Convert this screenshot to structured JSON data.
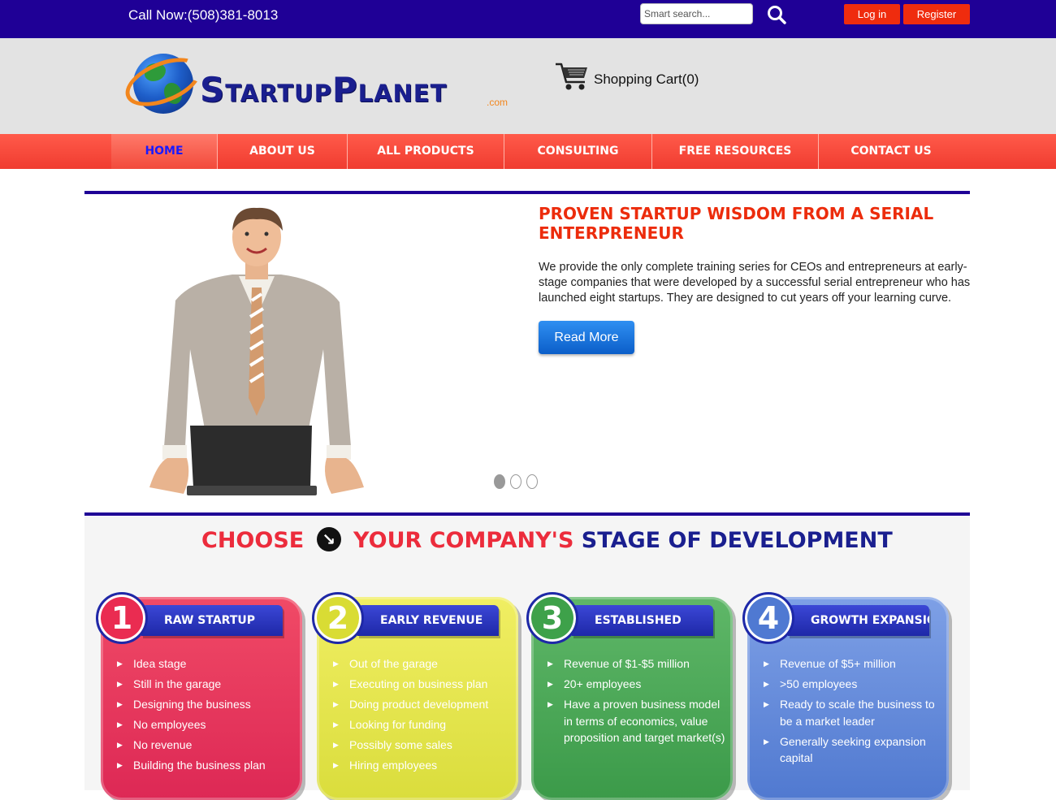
{
  "topbar": {
    "call_now": "Call Now:(508)381-8013",
    "search_placeholder": "Smart search...",
    "login_label": "Log in",
    "register_label": "Register",
    "search_icon": "magnifier-icon"
  },
  "header": {
    "logo_text": "StartupPlanet",
    "logo_suffix": ".com",
    "cart_label": "Shopping Cart(0)",
    "cart_icon": "shopping-cart-icon"
  },
  "nav": {
    "items": [
      {
        "label": "HOME",
        "active": true
      },
      {
        "label": "ABOUT US",
        "active": false
      },
      {
        "label": "ALL PRODUCTS",
        "active": false
      },
      {
        "label": "CONSULTING",
        "active": false
      },
      {
        "label": "FREE RESOURCES",
        "active": false
      },
      {
        "label": "CONTACT US",
        "active": false
      }
    ]
  },
  "hero": {
    "title": "PROVEN STARTUP WISDOM FROM A SERIAL ENTERPRENEUR",
    "text": "We provide the only complete training series for CEOs and entrepreneurs at early-stage companies that were developed by a successful serial entrepreneur who has launched eight startups. They are designed to cut years off your learning curve.",
    "read_more": "Read More",
    "slides": 3,
    "active_slide": 1
  },
  "stages": {
    "heading_part1": "CHOOSE",
    "heading_part2": "YOUR COMPANY'S",
    "heading_part3": "STAGE OF DEVELOPMENT",
    "cards": [
      {
        "number": "1",
        "title": "RAW STARTUP",
        "color": "#e42d57",
        "items": [
          "Idea stage",
          "Still in the garage",
          "Designing the business",
          "No employees",
          "No revenue",
          "Building the business plan"
        ]
      },
      {
        "number": "2",
        "title": "EARLY REVENUE",
        "color": "#dcdf3f",
        "items": [
          "Out of the garage",
          "Executing on business plan",
          "Doing product development",
          "Looking for funding",
          "Possibly some sales",
          "Hiring employees"
        ]
      },
      {
        "number": "3",
        "title": "ESTABLISHED",
        "color": "#46a453",
        "items": [
          "Revenue of $1-$5 million",
          "20+ employees",
          "Have a proven business model in terms of economics, value proposition and target market(s)"
        ]
      },
      {
        "number": "4",
        "title": "GROWTH EXPANSION",
        "color": "#5a81d6",
        "items": [
          "Revenue of $5+ million",
          ">50 employees",
          "Ready to scale the business to be a market leader",
          "Generally seeking expansion capital"
        ]
      }
    ]
  },
  "colors": {
    "topbar": "#1f0096",
    "accent_red": "#ef2c0e",
    "nav_red": "#f24a3b",
    "title_red": "#ec2c0c",
    "navy": "#1a1f8f"
  }
}
